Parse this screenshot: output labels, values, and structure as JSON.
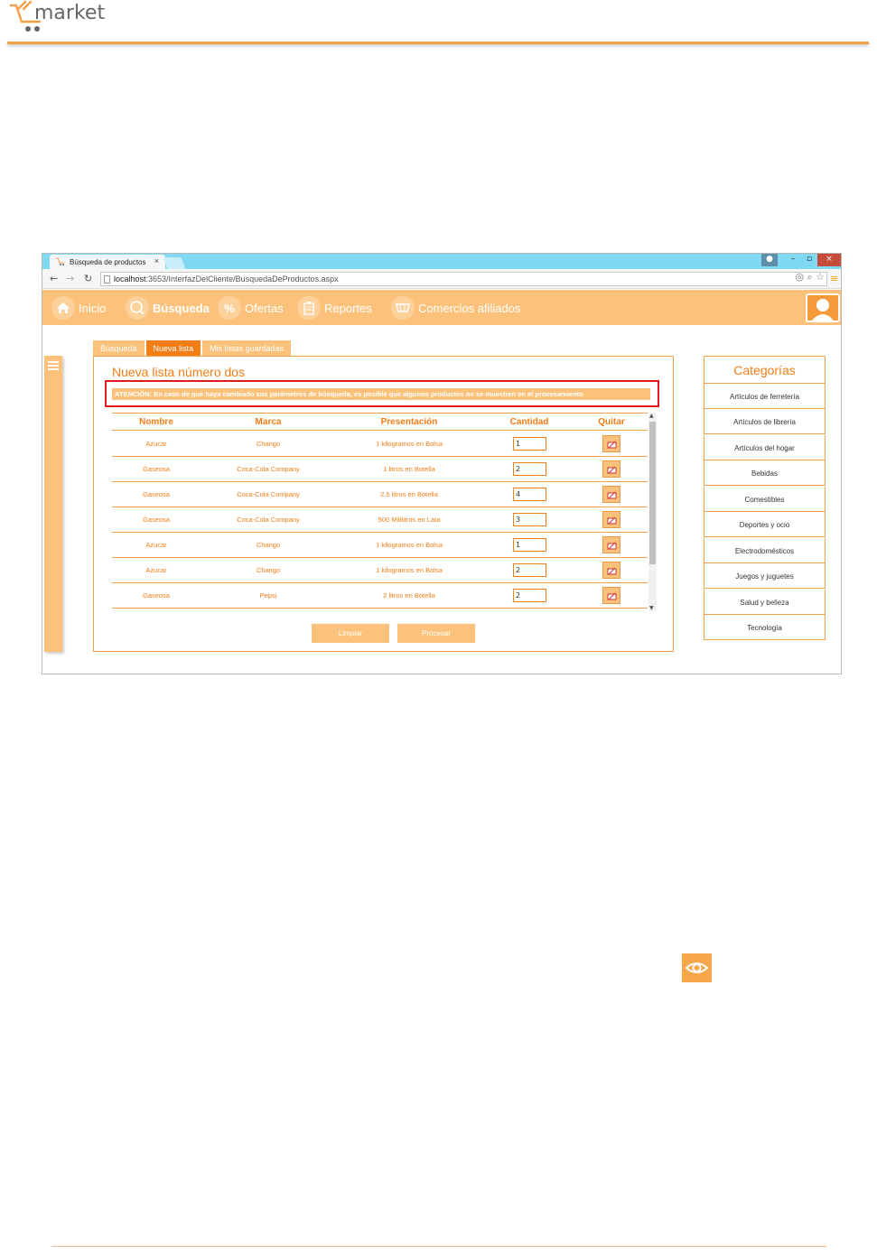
{
  "doc": {
    "logo_text": "ITmarket"
  },
  "browser": {
    "tab_title": "Búsqueda de productos",
    "url_host": "localhost",
    "url_path": ":3653/InterfazDelCliente/BusquedaDeProductos.aspx"
  },
  "nav": {
    "items": [
      {
        "label": "Inicio"
      },
      {
        "label": "Búsqueda"
      },
      {
        "label": "Ofertas"
      },
      {
        "label": "Reportes"
      },
      {
        "label": "Comercios afiliados"
      }
    ]
  },
  "tabs": [
    {
      "label": "Búsqueda"
    },
    {
      "label": "Nueva lista"
    },
    {
      "label": "Mis listas guardadas"
    }
  ],
  "panel": {
    "title": "Nueva lista número dos",
    "alert": "ATENCIÓN: En caso de que haya cambiado sus parámetros de búsqueda, es posible que algunos productos no se muestren en el procesamiento"
  },
  "table": {
    "headers": [
      "Nombre",
      "Marca",
      "Presentación",
      "Cantidad",
      "Quitar"
    ],
    "rows": [
      {
        "nombre": "Azucar",
        "marca": "Chango",
        "presentacion": "1 kilogramos en Bolsa",
        "cantidad": "1"
      },
      {
        "nombre": "Gaseosa",
        "marca": "Coca-Cola Company",
        "presentacion": "1 litros en Botella",
        "cantidad": "2"
      },
      {
        "nombre": "Gaseosa",
        "marca": "Coca-Cola Company",
        "presentacion": "2.5 litros en Botella",
        "cantidad": "4"
      },
      {
        "nombre": "Gaseosa",
        "marca": "Coca-Cola Company",
        "presentacion": "500 Mililitros en Lata",
        "cantidad": "3"
      },
      {
        "nombre": "Azucar",
        "marca": "Chango",
        "presentacion": "1 kilogramos en Bolsa",
        "cantidad": "1"
      },
      {
        "nombre": "Azucar",
        "marca": "Chango",
        "presentacion": "1 kilogramos en Bolsa",
        "cantidad": "2"
      },
      {
        "nombre": "Gaseosa",
        "marca": "Pepsi",
        "presentacion": "2 litros en Botella",
        "cantidad": "2"
      }
    ]
  },
  "buttons": {
    "clear": "Limpiar",
    "process": "Procesar"
  },
  "categories": {
    "title": "Categorías",
    "items": [
      "Artículos de ferretería",
      "Artículos de librería",
      "Artículos del hogar",
      "Bebidas",
      "Comestibles",
      "Deportes y ocio",
      "Electrodomésticos",
      "Juegos y juguetes",
      "Salud y belleza",
      "Tecnología"
    ]
  },
  "colors": {
    "accent": "#f47d16",
    "light_accent": "#fcc27b",
    "alert_border": "#e21a1a",
    "titlebar": "#7fd9f2"
  }
}
